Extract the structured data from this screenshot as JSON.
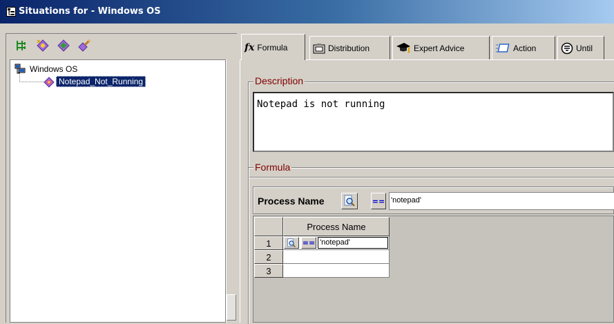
{
  "window": {
    "title": "Situations for - Windows OS"
  },
  "left_toolbar": {
    "icons": [
      "tree-expand-icon",
      "new-situation-icon",
      "create-another-icon",
      "delete-situation-icon"
    ]
  },
  "tree": {
    "root_label": "Windows OS",
    "child_label": "Notepad_Not_Running"
  },
  "tabs": [
    {
      "label": "Formula",
      "icon": "fx-icon",
      "active": true
    },
    {
      "label": "Distribution",
      "icon": "distribution-icon",
      "active": false
    },
    {
      "label": "Expert Advice",
      "icon": "mortarboard-icon",
      "active": false
    },
    {
      "label": "Action",
      "icon": "action-icon",
      "active": false
    },
    {
      "label": "Until",
      "icon": "until-icon",
      "active": false
    }
  ],
  "tab_icon_glyph": "fx",
  "description": {
    "title": "Description",
    "text": "Notepad is not running"
  },
  "formula": {
    "title": "Formula",
    "attribute_label": "Process Name",
    "operator": "==",
    "value": "'notepad'",
    "column_header": "Process Name",
    "rows": [
      {
        "num": "1",
        "operator": "==",
        "value": "'notepad'"
      },
      {
        "num": "2",
        "operator": "",
        "value": ""
      },
      {
        "num": "3",
        "operator": "",
        "value": ""
      }
    ]
  },
  "colors": {
    "title_start": "#0a246a",
    "selection": "#0a246a",
    "group_title": "#800000",
    "operator": "#0000cc"
  }
}
